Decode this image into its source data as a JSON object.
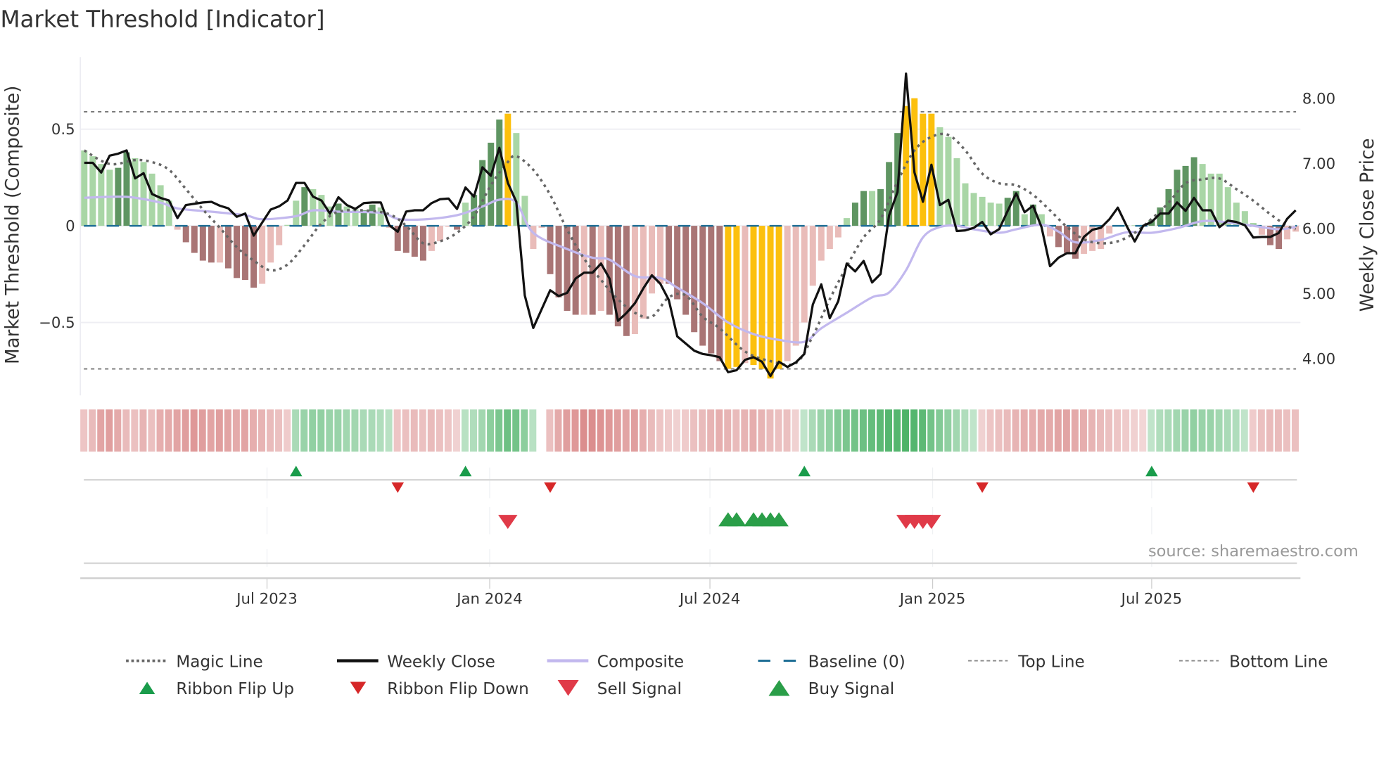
{
  "title": "Market Threshold [Indicator]",
  "source": "source: sharemaestro.com",
  "colors": {
    "strong_up": "#5f9562",
    "weak_up": "#a9d6a6",
    "strong_down": "#a97575",
    "weak_down": "#e9bcb9",
    "extreme": "#fcc00d",
    "weekly_close": "#111111",
    "composite": "#c2b8ee",
    "magic_line": "#666666",
    "baseline": "#1f6f96",
    "ribbon_up": "#34a853",
    "ribbon_down": "#d06a6a",
    "flip_up": "#1a9c4b",
    "flip_down": "#d62728",
    "sell": "#e03a48",
    "buy": "#2a9e48"
  },
  "chart_data": {
    "type": "bar",
    "title": "Market Threshold [Indicator]",
    "start_week": "2023-01-31",
    "frequency": "weekly",
    "ylabel": "Market Threshold (Composite)",
    "y2label": "Weekly Close Price",
    "ylim": [
      -0.85,
      0.9
    ],
    "y2lim": [
      3.6,
      8.6
    ],
    "yticks": [
      {
        "value": 0.5,
        "label": "0.5"
      },
      {
        "value": 0,
        "label": "0"
      },
      {
        "value": -0.5,
        "label": "−0.5"
      }
    ],
    "y2ticks": [
      {
        "value": 8,
        "label": "8.00"
      },
      {
        "value": 7,
        "label": "7.00"
      },
      {
        "value": 6,
        "label": "6.00"
      },
      {
        "value": 5,
        "label": "5.00"
      },
      {
        "value": 4,
        "label": "4.00"
      }
    ],
    "xticks": [
      {
        "date": "2023-07-01",
        "label": "Jul 2023"
      },
      {
        "date": "2024-01-01",
        "label": "Jan 2024"
      },
      {
        "date": "2024-07-01",
        "label": "Jul 2024"
      },
      {
        "date": "2025-01-01",
        "label": "Jan 2025"
      },
      {
        "date": "2025-07-01",
        "label": "Jul 2025"
      }
    ],
    "top_line": 0.59,
    "bottom_line": -0.74,
    "baseline": 0,
    "bar_color_key": {
      "G": "strong_up",
      "g": "weak_up",
      "R": "strong_down",
      "r": "weak_down",
      "Y": "extreme"
    },
    "bar_colors": "ggggGGgggggrRRRRrRRRRrrrggGgggGggGGgrRRRRrrrRgGGGGYggrrRRRRrRrRRRrrrrRRRRRRRYYrYYYYrrrrrrrgGGgGGGYYYYggggggggGGgGgrRRRrrrrggggGGGGGGgggggggrRRrr",
    "composite_bars": [
      0.39,
      0.36,
      0.32,
      0.29,
      0.3,
      0.38,
      0.35,
      0.33,
      0.27,
      0.21,
      0.13,
      -0.02,
      -0.085,
      -0.14,
      -0.18,
      -0.19,
      -0.19,
      -0.22,
      -0.27,
      -0.28,
      -0.32,
      -0.3,
      -0.19,
      -0.1,
      0.005,
      0.13,
      0.2,
      0.19,
      0.16,
      0.1,
      0.115,
      0.1,
      0.085,
      0.08,
      0.11,
      0.095,
      -0.01,
      -0.13,
      -0.14,
      -0.16,
      -0.18,
      -0.13,
      -0.08,
      -0.005,
      -0.02,
      0.12,
      0.16,
      0.34,
      0.43,
      0.55,
      0.58,
      0.48,
      0.155,
      -0.12,
      -0.01,
      -0.25,
      -0.37,
      -0.44,
      -0.46,
      -0.46,
      -0.46,
      -0.44,
      -0.46,
      -0.52,
      -0.57,
      -0.56,
      -0.48,
      -0.35,
      -0.3,
      -0.3,
      -0.38,
      -0.46,
      -0.55,
      -0.62,
      -0.66,
      -0.7,
      -0.74,
      -0.73,
      -0.71,
      -0.72,
      -0.74,
      -0.79,
      -0.74,
      -0.7,
      -0.62,
      -0.5,
      -0.31,
      -0.18,
      -0.12,
      -0.06,
      0.04,
      0.12,
      0.18,
      0.18,
      0.19,
      0.33,
      0.48,
      0.62,
      0.66,
      0.58,
      0.58,
      0.51,
      0.46,
      0.35,
      0.22,
      0.17,
      0.15,
      0.12,
      0.115,
      0.145,
      0.18,
      0.06,
      0.11,
      0.06,
      -0.055,
      -0.11,
      -0.14,
      -0.17,
      -0.145,
      -0.13,
      -0.12,
      -0.04,
      0.003,
      0.003,
      0.003,
      0.005,
      0.03,
      0.095,
      0.19,
      0.29,
      0.31,
      0.355,
      0.32,
      0.27,
      0.27,
      0.2,
      0.12,
      0.076,
      0.015,
      -0.046,
      -0.1,
      -0.12,
      -0.07,
      -0.03
    ],
    "weekly_close": [
      7.01,
      7.01,
      6.86,
      7.12,
      7.15,
      7.2,
      6.77,
      6.85,
      6.53,
      6.47,
      6.43,
      6.16,
      6.36,
      6.38,
      6.4,
      6.41,
      6.35,
      6.31,
      6.18,
      6.23,
      5.89,
      6.09,
      6.29,
      6.34,
      6.43,
      6.7,
      6.7,
      6.49,
      6.43,
      6.23,
      6.48,
      6.36,
      6.3,
      6.39,
      6.4,
      6.4,
      6.05,
      5.95,
      6.26,
      6.28,
      6.28,
      6.39,
      6.45,
      6.46,
      6.3,
      6.63,
      6.49,
      6.94,
      6.81,
      7.24,
      6.7,
      6.41,
      4.97,
      4.47,
      4.76,
      5.05,
      4.96,
      5.01,
      5.23,
      5.32,
      5.32,
      5.46,
      5.23,
      4.58,
      4.7,
      4.85,
      5.08,
      5.28,
      5.15,
      4.9,
      4.34,
      4.23,
      4.12,
      4.07,
      4.05,
      4.02,
      3.79,
      3.82,
      3.98,
      4.02,
      3.95,
      3.73,
      3.95,
      3.87,
      3.94,
      4.07,
      4.83,
      5.14,
      4.62,
      4.88,
      5.46,
      5.34,
      5.5,
      5.17,
      5.3,
      6.2,
      6.56,
      8.38,
      6.86,
      6.41,
      6.98,
      6.36,
      6.44,
      5.96,
      5.97,
      6.01,
      6.1,
      5.91,
      5.99,
      6.27,
      6.54,
      6.25,
      6.35,
      6.02,
      5.42,
      5.55,
      5.62,
      5.62,
      5.87,
      5.98,
      6.01,
      6.14,
      6.32,
      6.05,
      5.8,
      6.04,
      6.1,
      6.23,
      6.23,
      6.4,
      6.27,
      6.47,
      6.28,
      6.28,
      6.02,
      6.12,
      6.1,
      6.05,
      5.86,
      5.87,
      5.87,
      5.93,
      6.15,
      6.28
    ],
    "composite_line": [
      [
        0,
        0.145
      ],
      [
        5,
        0.15
      ],
      [
        9,
        0.12
      ],
      [
        11,
        0.09
      ],
      [
        15,
        0.073
      ],
      [
        19,
        0.055
      ],
      [
        21,
        0.034
      ],
      [
        25,
        0.05
      ],
      [
        27,
        0.08
      ],
      [
        30,
        0.073
      ],
      [
        35,
        0.067
      ],
      [
        37,
        0.036
      ],
      [
        40,
        0.033
      ],
      [
        44,
        0.055
      ],
      [
        47,
        0.1
      ],
      [
        49,
        0.135
      ],
      [
        51,
        0.12
      ],
      [
        53,
        -0.036
      ],
      [
        57,
        -0.12
      ],
      [
        60,
        -0.165
      ],
      [
        62,
        -0.175
      ],
      [
        65,
        -0.26
      ],
      [
        68,
        -0.27
      ],
      [
        70,
        -0.32
      ],
      [
        73,
        -0.4
      ],
      [
        76,
        -0.5
      ],
      [
        79,
        -0.56
      ],
      [
        82,
        -0.59
      ],
      [
        85,
        -0.6
      ],
      [
        87,
        -0.53
      ],
      [
        90,
        -0.45
      ],
      [
        93,
        -0.37
      ],
      [
        95,
        -0.345
      ],
      [
        97,
        -0.23
      ],
      [
        99,
        -0.06
      ],
      [
        101,
        -0.006
      ],
      [
        103,
        0
      ],
      [
        105,
        -0.018
      ],
      [
        108,
        -0.036
      ],
      [
        110,
        -0.018
      ],
      [
        113,
        0.006
      ],
      [
        115,
        -0.03
      ],
      [
        117,
        -0.085
      ],
      [
        120,
        -0.073
      ],
      [
        123,
        -0.034
      ],
      [
        126,
        -0.036
      ],
      [
        129,
        -0.012
      ],
      [
        132,
        0.024
      ],
      [
        135,
        0.018
      ],
      [
        138,
        0
      ],
      [
        141,
        -0.018
      ],
      [
        143,
        -0.006
      ]
    ],
    "magic_line": [
      [
        0,
        0.39
      ],
      [
        3,
        0.32
      ],
      [
        6,
        0.34
      ],
      [
        8,
        0.33
      ],
      [
        10,
        0.29
      ],
      [
        12,
        0.19
      ],
      [
        14,
        0.085
      ],
      [
        16,
        -0.01
      ],
      [
        18,
        -0.11
      ],
      [
        20,
        -0.18
      ],
      [
        22,
        -0.23
      ],
      [
        24,
        -0.2
      ],
      [
        26,
        -0.1
      ],
      [
        28,
        0.012
      ],
      [
        30,
        0.073
      ],
      [
        33,
        0.08
      ],
      [
        36,
        0.06
      ],
      [
        38,
        0.0
      ],
      [
        40,
        -0.09
      ],
      [
        42,
        -0.08
      ],
      [
        44,
        -0.036
      ],
      [
        46,
        0.05
      ],
      [
        48,
        0.21
      ],
      [
        50,
        0.33
      ],
      [
        51,
        0.36
      ],
      [
        53,
        0.29
      ],
      [
        55,
        0.16
      ],
      [
        57,
        -0.02
      ],
      [
        59,
        -0.17
      ],
      [
        61,
        -0.28
      ],
      [
        63,
        -0.38
      ],
      [
        65,
        -0.45
      ],
      [
        67,
        -0.47
      ],
      [
        69,
        -0.37
      ],
      [
        71,
        -0.36
      ],
      [
        73,
        -0.47
      ],
      [
        75,
        -0.53
      ],
      [
        78,
        -0.65
      ],
      [
        81,
        -0.7
      ],
      [
        84,
        -0.71
      ],
      [
        86,
        -0.57
      ],
      [
        88,
        -0.38
      ],
      [
        90,
        -0.21
      ],
      [
        92,
        -0.06
      ],
      [
        94,
        0.036
      ],
      [
        96,
        0.23
      ],
      [
        98,
        0.39
      ],
      [
        100,
        0.46
      ],
      [
        102,
        0.47
      ],
      [
        104,
        0.39
      ],
      [
        106,
        0.27
      ],
      [
        108,
        0.22
      ],
      [
        110,
        0.21
      ],
      [
        112,
        0.16
      ],
      [
        114,
        0.08
      ],
      [
        116,
        -0.006
      ],
      [
        118,
        -0.07
      ],
      [
        120,
        -0.09
      ],
      [
        122,
        -0.08
      ],
      [
        124,
        -0.036
      ],
      [
        126,
        0.036
      ],
      [
        128,
        0.12
      ],
      [
        130,
        0.22
      ],
      [
        132,
        0.24
      ],
      [
        134,
        0.245
      ],
      [
        136,
        0.19
      ],
      [
        138,
        0.13
      ],
      [
        140,
        0.06
      ],
      [
        142,
        0.0
      ],
      [
        143,
        -0.018
      ]
    ],
    "ribbon": [
      -0.25,
      -0.35,
      -0.55,
      -0.6,
      -0.5,
      -0.35,
      -0.3,
      -0.4,
      -0.3,
      -0.45,
      -0.5,
      -0.55,
      -0.6,
      -0.65,
      -0.6,
      -0.55,
      -0.6,
      -0.55,
      -0.5,
      -0.55,
      -0.45,
      -0.4,
      -0.35,
      -0.3,
      -0.2,
      0.3,
      0.4,
      0.45,
      0.45,
      0.4,
      0.4,
      0.35,
      0.35,
      0.3,
      0.3,
      0.25,
      0.2,
      -0.25,
      -0.3,
      -0.35,
      -0.3,
      -0.35,
      -0.3,
      -0.25,
      -0.15,
      0.2,
      0.25,
      0.35,
      0.5,
      0.6,
      0.7,
      0.65,
      0.5,
      0.2,
      null,
      -0.3,
      -0.5,
      -0.6,
      -0.65,
      -0.75,
      -0.75,
      -0.7,
      -0.65,
      -0.6,
      -0.55,
      -0.6,
      -0.45,
      -0.35,
      -0.25,
      -0.2,
      -0.15,
      -0.2,
      -0.3,
      -0.35,
      -0.4,
      -0.45,
      -0.4,
      -0.35,
      -0.4,
      -0.45,
      -0.4,
      -0.35,
      -0.3,
      -0.3,
      -0.15,
      0.15,
      0.3,
      0.4,
      0.45,
      0.55,
      0.6,
      0.65,
      0.7,
      0.75,
      0.8,
      0.85,
      0.85,
      0.9,
      0.85,
      0.8,
      0.65,
      0.55,
      0.45,
      0.35,
      0.25,
      0.15,
      -0.15,
      -0.25,
      -0.3,
      -0.35,
      -0.4,
      -0.45,
      -0.45,
      -0.5,
      -0.5,
      -0.55,
      -0.55,
      -0.5,
      -0.45,
      -0.4,
      -0.35,
      -0.3,
      -0.25,
      -0.2,
      -0.15,
      -0.1,
      0.15,
      0.25,
      0.3,
      0.35,
      0.4,
      0.45,
      0.4,
      0.4,
      0.35,
      0.3,
      0.25,
      0.15,
      -0.2,
      -0.3,
      -0.35,
      -0.35,
      -0.3,
      -0.3
    ],
    "ribbon_flip_up_weeks": [
      25,
      45,
      85,
      126
    ],
    "ribbon_flip_down_weeks": [
      37,
      55,
      106,
      138
    ],
    "sell_signal_weeks": [
      50,
      97,
      98,
      99,
      100
    ],
    "buy_signal_weeks": [
      76,
      77,
      79,
      80,
      81,
      82
    ],
    "grid": true,
    "legend_position": "bottom",
    "legend": [
      {
        "key": "magic",
        "label": "Magic Line"
      },
      {
        "key": "close",
        "label": "Weekly Close"
      },
      {
        "key": "composite",
        "label": "Composite"
      },
      {
        "key": "baseline",
        "label": "Baseline (0)"
      },
      {
        "key": "top",
        "label": "Top Line"
      },
      {
        "key": "bottom",
        "label": "Bottom Line"
      },
      {
        "key": "flipup",
        "label": "Ribbon Flip Up"
      },
      {
        "key": "flipdown",
        "label": "Ribbon Flip Down"
      },
      {
        "key": "sell",
        "label": "Sell Signal"
      },
      {
        "key": "buy",
        "label": "Buy Signal"
      }
    ]
  }
}
